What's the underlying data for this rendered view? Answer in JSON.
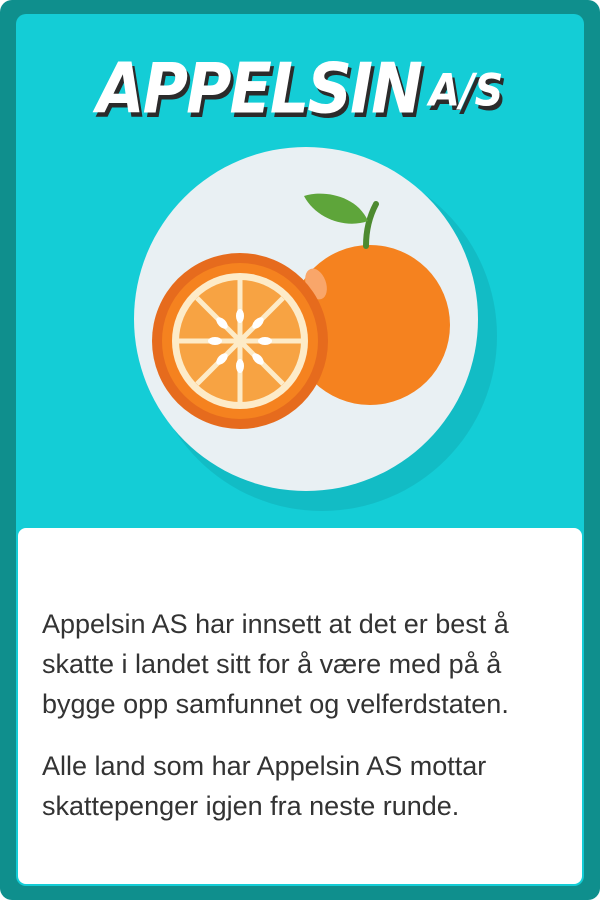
{
  "card": {
    "title": "APPELSIN",
    "title_suffix": "A/S",
    "image": "orange-illustration",
    "description": [
      "Appelsin AS har innsett at det er best å skatte i landet sitt for å være med på å bygge opp samfunnet og velferdstaten.",
      "Alle land som har Appelsin AS mottar skattepenger igjen fra neste runde."
    ]
  },
  "colors": {
    "frame": "#0f8f8d",
    "background": "#14cdd6",
    "plate": "#e9f0f3",
    "orange": "#f5821f",
    "leaf": "#5ea53a",
    "text": "#333333"
  }
}
